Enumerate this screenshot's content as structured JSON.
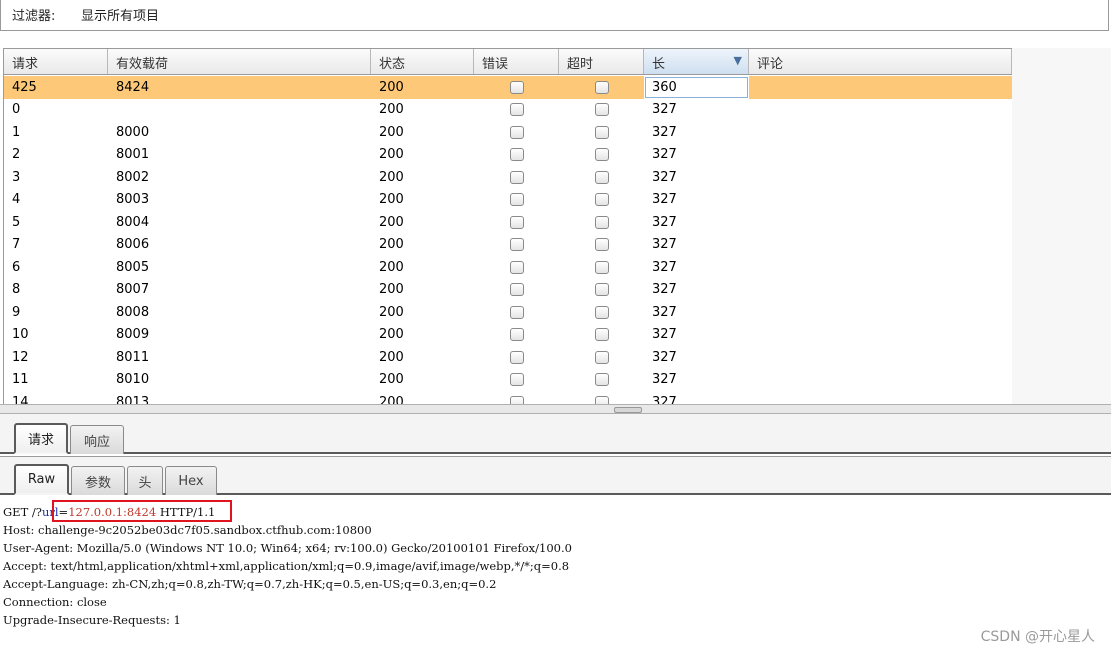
{
  "filter": {
    "label": "过滤器:",
    "value": "显示所有项目"
  },
  "table": {
    "columns": [
      {
        "label": "请求"
      },
      {
        "label": "有效载荷"
      },
      {
        "label": "状态"
      },
      {
        "label": "错误"
      },
      {
        "label": "超时"
      },
      {
        "label": "长",
        "sorted": true
      },
      {
        "label": "评论"
      }
    ],
    "rows": [
      {
        "request": "425",
        "payload": "8424",
        "status": "200",
        "error": false,
        "timeout": false,
        "length": "360",
        "comment": "",
        "selected": true
      },
      {
        "request": "0",
        "payload": "",
        "status": "200",
        "error": false,
        "timeout": false,
        "length": "327",
        "comment": ""
      },
      {
        "request": "1",
        "payload": "8000",
        "status": "200",
        "error": false,
        "timeout": false,
        "length": "327",
        "comment": ""
      },
      {
        "request": "2",
        "payload": "8001",
        "status": "200",
        "error": false,
        "timeout": false,
        "length": "327",
        "comment": ""
      },
      {
        "request": "3",
        "payload": "8002",
        "status": "200",
        "error": false,
        "timeout": false,
        "length": "327",
        "comment": ""
      },
      {
        "request": "4",
        "payload": "8003",
        "status": "200",
        "error": false,
        "timeout": false,
        "length": "327",
        "comment": ""
      },
      {
        "request": "5",
        "payload": "8004",
        "status": "200",
        "error": false,
        "timeout": false,
        "length": "327",
        "comment": ""
      },
      {
        "request": "7",
        "payload": "8006",
        "status": "200",
        "error": false,
        "timeout": false,
        "length": "327",
        "comment": ""
      },
      {
        "request": "6",
        "payload": "8005",
        "status": "200",
        "error": false,
        "timeout": false,
        "length": "327",
        "comment": ""
      },
      {
        "request": "8",
        "payload": "8007",
        "status": "200",
        "error": false,
        "timeout": false,
        "length": "327",
        "comment": ""
      },
      {
        "request": "9",
        "payload": "8008",
        "status": "200",
        "error": false,
        "timeout": false,
        "length": "327",
        "comment": ""
      },
      {
        "request": "10",
        "payload": "8009",
        "status": "200",
        "error": false,
        "timeout": false,
        "length": "327",
        "comment": ""
      },
      {
        "request": "12",
        "payload": "8011",
        "status": "200",
        "error": false,
        "timeout": false,
        "length": "327",
        "comment": ""
      },
      {
        "request": "11",
        "payload": "8010",
        "status": "200",
        "error": false,
        "timeout": false,
        "length": "327",
        "comment": ""
      },
      {
        "request": "14",
        "payload": "8013",
        "status": "200",
        "error": false,
        "timeout": false,
        "length": "327",
        "comment": ""
      }
    ]
  },
  "detail_tabs": [
    {
      "label": "请求",
      "active": true
    },
    {
      "label": "响应",
      "active": false
    }
  ],
  "view_tabs": [
    {
      "label": "Raw",
      "active": true
    },
    {
      "label": "参数",
      "active": false
    },
    {
      "label": "头",
      "active": false
    },
    {
      "label": "Hex",
      "active": false
    }
  ],
  "raw_request": {
    "line1_prefix": "GET /?",
    "param_key": "url",
    "param_eq": "=",
    "param_value": "127.0.0.1:8424",
    "line1_suffix": " HTTP/1.1",
    "headers": [
      "Host: challenge-9c2052be03dc7f05.sandbox.ctfhub.com:10800",
      "User-Agent: Mozilla/5.0 (Windows NT 10.0; Win64; x64; rv:100.0) Gecko/20100101 Firefox/100.0",
      "Accept: text/html,application/xhtml+xml,application/xml;q=0.9,image/avif,image/webp,*/*;q=0.8",
      "Accept-Language: zh-CN,zh;q=0.8,zh-TW;q=0.7,zh-HK;q=0.5,en-US;q=0.3,en;q=0.2",
      "Connection: close",
      "Upgrade-Insecure-Requests: 1"
    ]
  },
  "watermark": "CSDN @开心星人",
  "colors": {
    "selected_row": "#fdc878",
    "highlight_box": "#e0141e",
    "param_key": "#1c2fa8",
    "param_value": "#c0392b"
  }
}
